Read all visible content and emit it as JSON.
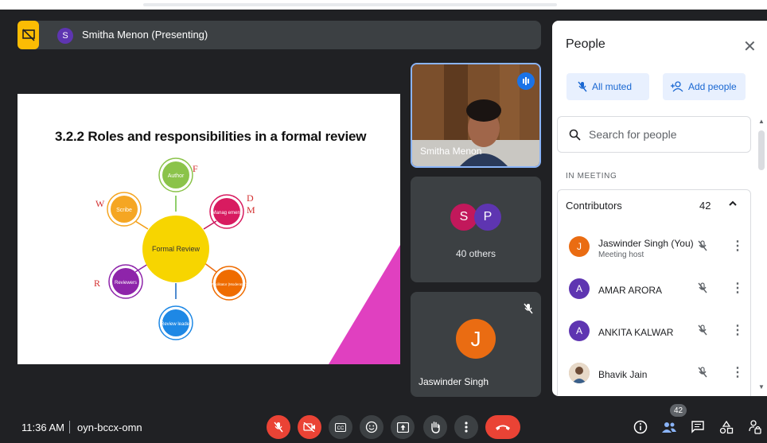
{
  "presenter": {
    "avatar_letter": "S",
    "label": "Smitha Menon (Presenting)"
  },
  "slide": {
    "title": "3.2.2 Roles and responsibilities in a formal review",
    "center": "Formal Review",
    "nodes": [
      "Author",
      "Manag ement",
      "Facilitator (Moderator)",
      "Review leader",
      "Reviewers",
      "Scribe"
    ],
    "annotations": [
      "F",
      "D",
      "M",
      "W",
      "R"
    ]
  },
  "tiles": {
    "video_name": "Smitha Menon",
    "others_avatars": [
      {
        "letter": "S",
        "color": "#c2185b"
      },
      {
        "letter": "P",
        "color": "#5e35b1"
      }
    ],
    "others_label": "40 others",
    "user_letter": "J",
    "user_name": "Jaswinder Singh"
  },
  "people_panel": {
    "title": "People",
    "all_muted": "All muted",
    "add_people": "Add people",
    "search_placeholder": "Search for people",
    "section": "IN MEETING",
    "contributors_label": "Contributors",
    "contributors_count": "42",
    "people": [
      {
        "letter": "J",
        "color": "#ea6c12",
        "name": "Jaswinder Singh (You)",
        "sub": "Meeting host"
      },
      {
        "letter": "A",
        "color": "#5e35b1",
        "name": "AMAR ARORA",
        "sub": ""
      },
      {
        "letter": "A",
        "color": "#5e35b1",
        "name": "ANKITA KALWAR",
        "sub": ""
      },
      {
        "letter": "",
        "color": "#c8a27a",
        "name": "Bhavik Jain",
        "sub": ""
      }
    ]
  },
  "bottom": {
    "time": "11:36 AM",
    "meeting_code": "oyn-bccx-omn",
    "participants_badge": "42"
  },
  "colors": {
    "accent_blue": "#1a73e8",
    "danger_red": "#ea4335",
    "presenting_yellow": "#fbbc04"
  }
}
